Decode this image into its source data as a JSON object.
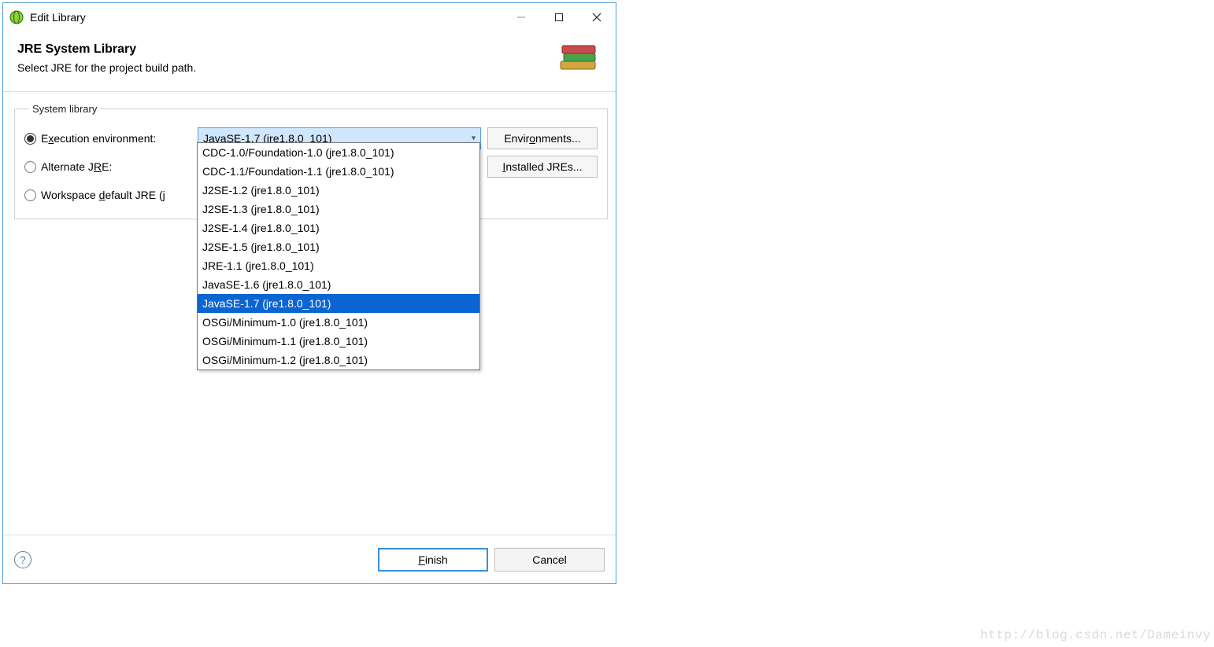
{
  "window": {
    "title": "Edit Library"
  },
  "header": {
    "title": "JRE System Library",
    "subtitle": "Select JRE for the project build path."
  },
  "fieldset": {
    "legend": "System library",
    "radios": {
      "exec_env": {
        "prefix": "E",
        "u": "x",
        "suffix": "ecution environment:",
        "checked": true
      },
      "alt_jre": {
        "prefix": "Alternate J",
        "u": "R",
        "suffix": "E:",
        "checked": false
      },
      "workspace_default": {
        "prefix": "Workspace ",
        "u": "d",
        "suffix": "efault JRE (j",
        "checked": false
      }
    },
    "combo_value": "JavaSE-1.7 (jre1.8.0_101)",
    "environments_btn": {
      "prefix": "Envir",
      "u": "o",
      "suffix": "nments..."
    },
    "installed_jres_btn": {
      "prefix": "",
      "u": "I",
      "suffix": "nstalled JREs..."
    }
  },
  "dropdown_options": [
    {
      "label": "CDC-1.0/Foundation-1.0 (jre1.8.0_101)",
      "selected": false
    },
    {
      "label": "CDC-1.1/Foundation-1.1 (jre1.8.0_101)",
      "selected": false
    },
    {
      "label": "J2SE-1.2 (jre1.8.0_101)",
      "selected": false
    },
    {
      "label": "J2SE-1.3 (jre1.8.0_101)",
      "selected": false
    },
    {
      "label": "J2SE-1.4 (jre1.8.0_101)",
      "selected": false
    },
    {
      "label": "J2SE-1.5 (jre1.8.0_101)",
      "selected": false
    },
    {
      "label": "JRE-1.1 (jre1.8.0_101)",
      "selected": false
    },
    {
      "label": "JavaSE-1.6 (jre1.8.0_101)",
      "selected": false
    },
    {
      "label": "JavaSE-1.7 (jre1.8.0_101)",
      "selected": true
    },
    {
      "label": "OSGi/Minimum-1.0 (jre1.8.0_101)",
      "selected": false
    },
    {
      "label": "OSGi/Minimum-1.1 (jre1.8.0_101)",
      "selected": false
    },
    {
      "label": "OSGi/Minimum-1.2 (jre1.8.0_101)",
      "selected": false
    }
  ],
  "footer": {
    "finish": {
      "prefix": "",
      "u": "F",
      "suffix": "inish"
    },
    "cancel": "Cancel"
  },
  "watermark": "http://blog.csdn.net/Dameinvy"
}
